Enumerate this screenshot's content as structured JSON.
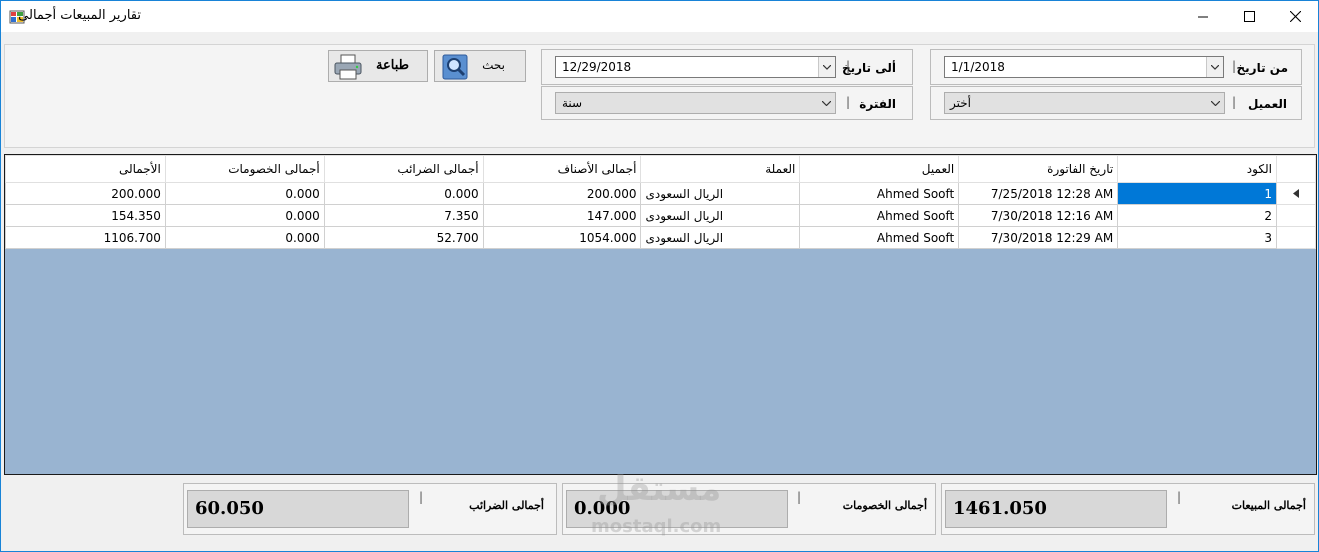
{
  "window": {
    "title": "تقارير المبيعات أجمالى"
  },
  "filters": {
    "from_date_label": "من تاريخ",
    "from_date_value": "1/1/2018",
    "to_date_label": "ألى تاريخ",
    "to_date_value": "12/29/2018",
    "customer_label": "العميل",
    "customer_value": "أختر",
    "period_label": "الفترة",
    "period_value": "سنة",
    "separator": "|"
  },
  "toolbar": {
    "search_label": "بحث",
    "print_label": "طباعة"
  },
  "table": {
    "columns": [
      "الكود",
      "تاريخ الفاتورة",
      "العميل",
      "العملة",
      "أجمالى الأصناف",
      "أجمالى الضرائب",
      "أجمالى الخصومات",
      "الأجمالى"
    ],
    "rows": [
      [
        "1",
        "7/25/2018 12:28 AM",
        "Ahmed Sooft",
        "الريال السعودى",
        "200.000",
        "0.000",
        "0.000",
        "200.000"
      ],
      [
        "2",
        "7/30/2018 12:16 AM",
        "Ahmed Sooft",
        "الريال السعودى",
        "147.000",
        "7.350",
        "0.000",
        "154.350"
      ],
      [
        "3",
        "7/30/2018 12:29 AM",
        "Ahmed Sooft",
        "الريال السعودى",
        "1054.000",
        "52.700",
        "0.000",
        "1106.700"
      ]
    ]
  },
  "totals": {
    "sales_label": "أجمالى المبيعات",
    "sales_value": "1461.050",
    "discounts_label": "أجمالى الخصومات",
    "discounts_value": "0.000",
    "taxes_label": "أجمالى الضرائب",
    "taxes_value": "60.050"
  },
  "watermark": {
    "arabic": "مستقل",
    "latin": "mostaql.com"
  },
  "colors": {
    "selection": "#0078d7",
    "grid_background": "#99b4d1",
    "titlebar_border": "#1883d7"
  },
  "icons": [
    "app-icon",
    "minimize-icon",
    "maximize-icon",
    "close-icon",
    "search-icon",
    "printer-icon",
    "dropdown-arrow-icon",
    "row-pointer-icon"
  ]
}
